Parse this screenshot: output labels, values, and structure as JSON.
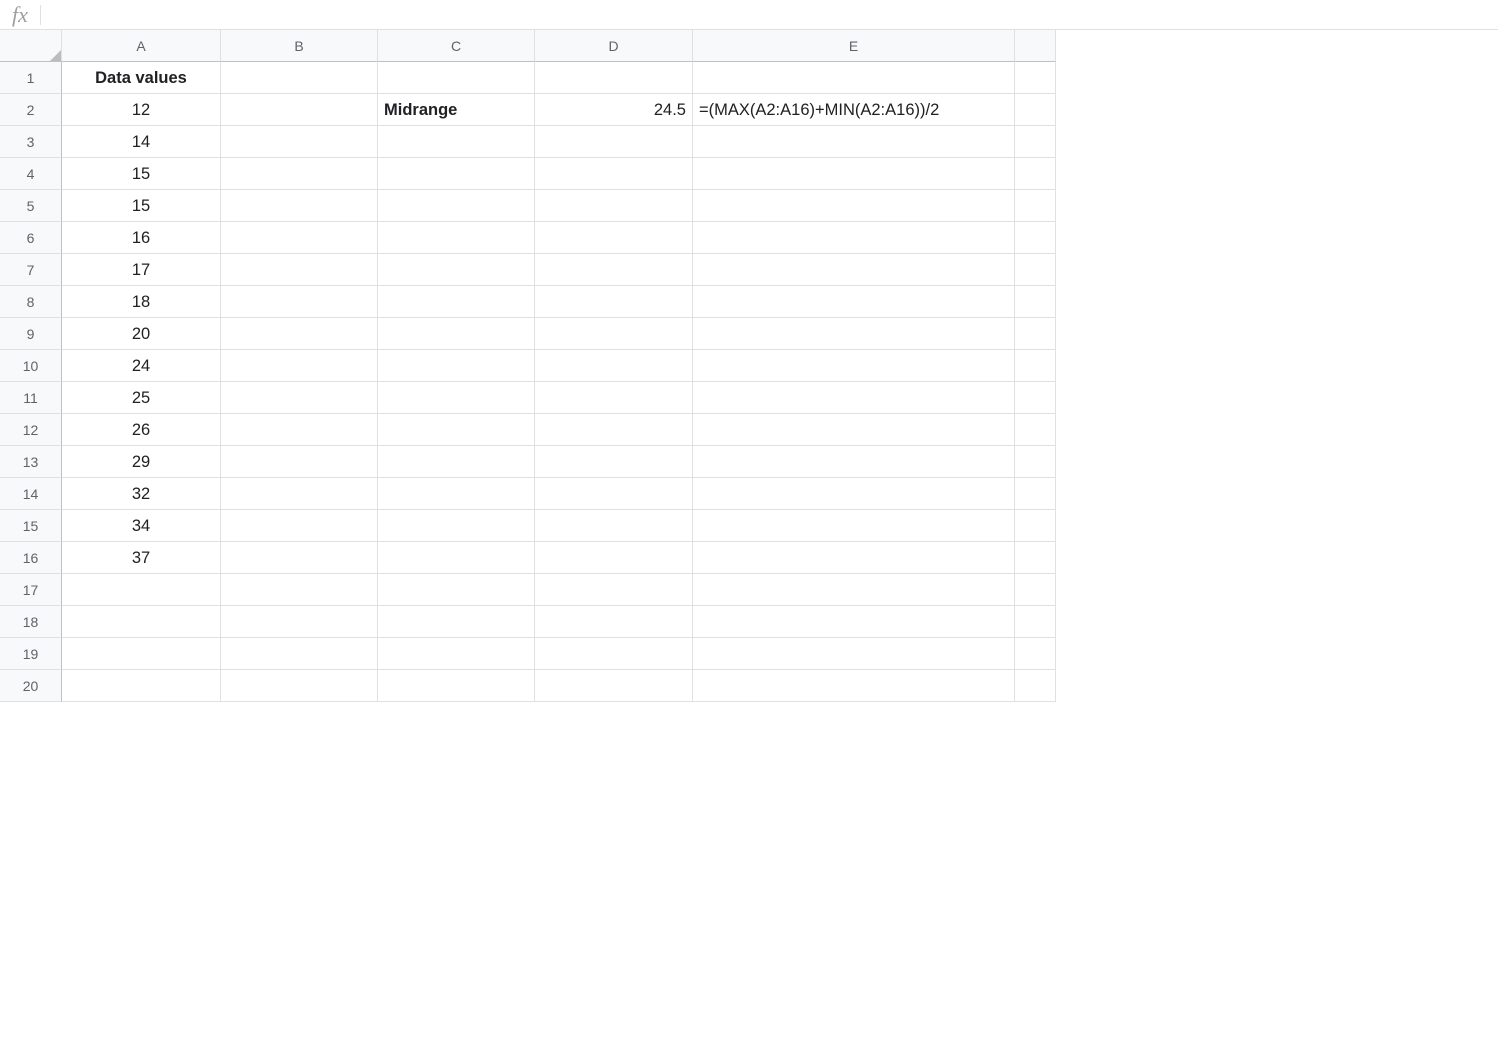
{
  "formula_bar": {
    "fx_label": "fx",
    "value": ""
  },
  "columns": [
    "A",
    "B",
    "C",
    "D",
    "E",
    ""
  ],
  "row_count": 20,
  "cells": {
    "A1": {
      "value": "Data values",
      "bold": true,
      "align": "center"
    },
    "A2": {
      "value": "12",
      "align": "center"
    },
    "A3": {
      "value": "14",
      "align": "center"
    },
    "A4": {
      "value": "15",
      "align": "center"
    },
    "A5": {
      "value": "15",
      "align": "center"
    },
    "A6": {
      "value": "16",
      "align": "center"
    },
    "A7": {
      "value": "17",
      "align": "center"
    },
    "A8": {
      "value": "18",
      "align": "center"
    },
    "A9": {
      "value": "20",
      "align": "center"
    },
    "A10": {
      "value": "24",
      "align": "center"
    },
    "A11": {
      "value": "25",
      "align": "center"
    },
    "A12": {
      "value": "26",
      "align": "center"
    },
    "A13": {
      "value": "29",
      "align": "center"
    },
    "A14": {
      "value": "32",
      "align": "center"
    },
    "A15": {
      "value": "34",
      "align": "center"
    },
    "A16": {
      "value": "37",
      "align": "center"
    },
    "C2": {
      "value": "Midrange",
      "bold": true,
      "align": "left"
    },
    "D2": {
      "value": "24.5",
      "align": "right"
    },
    "E2": {
      "value": "=(MAX(A2:A16)+MIN(A2:A16))/2",
      "align": "left"
    }
  }
}
